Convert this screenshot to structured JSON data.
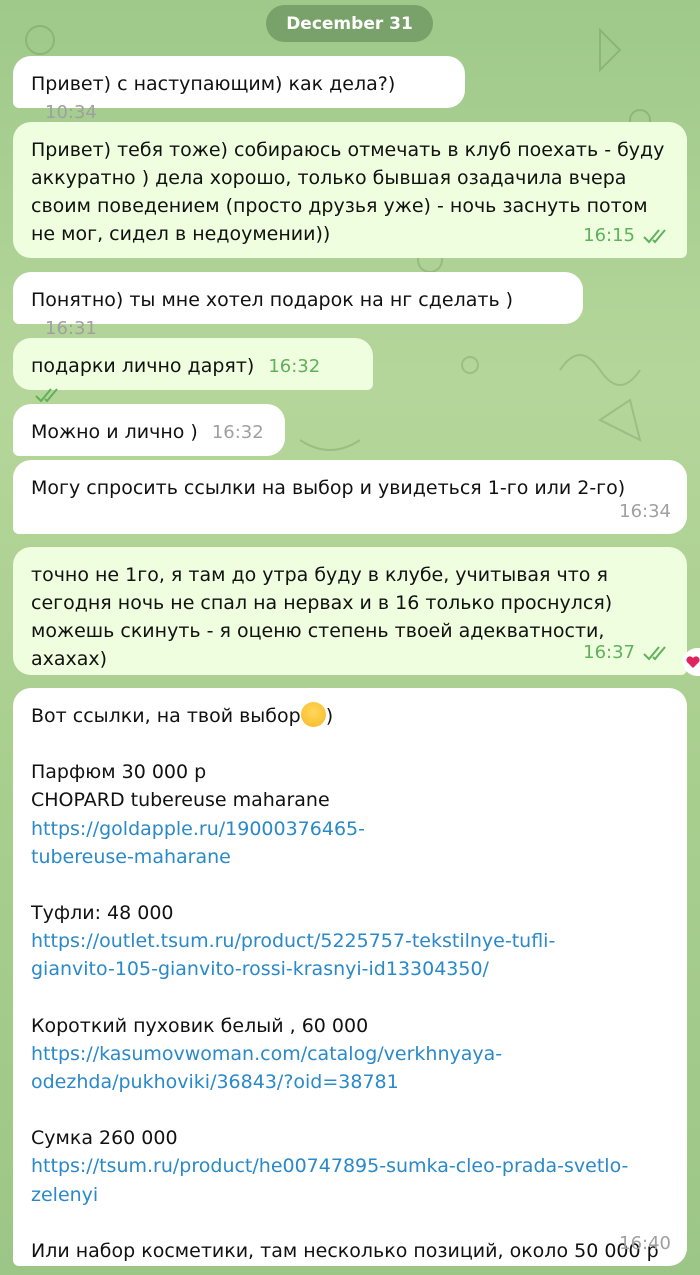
{
  "date_label": "December 31",
  "messages": [
    {
      "dir": "in",
      "text": "Привет) с наступающим) как дела?)",
      "time": "10:34"
    },
    {
      "dir": "out",
      "text": "Привет) тебя тоже) собираюсь отмечать в клуб поехать - буду аккуратно ) дела хорошо, только бывшая озадачила вчера своим поведением (просто друзья уже) - ночь заснуть потом не мог, сидел в недоумении))",
      "time": "16:15"
    },
    {
      "dir": "in",
      "text": "Понятно) ты мне хотел подарок на нг сделать )",
      "time": "16:31"
    },
    {
      "dir": "out",
      "text": "подарки лично дарят)",
      "time": "16:32"
    },
    {
      "dir": "in",
      "text": "Можно и лично )",
      "time": "16:32"
    },
    {
      "dir": "in",
      "text": "Могу спросить ссылки на выбор и увидеться 1-го или 2-го)",
      "time": "16:34"
    },
    {
      "dir": "out",
      "text": "точно не 1го, я там до утра буду в клубе, учитывая что я сегодня ночь не спал на нервах и в 16 только проснулся) можешь скинуть - я оценю степень твоей адекватности, ахахах)",
      "time": "16:37"
    }
  ],
  "links_message": {
    "intro_text": "Вот ссылки, на твой выбор",
    "intro_suffix": ")",
    "perfume_title": "Парфюм 30 000 р",
    "perfume_desc": "CHOPARD tubereuse maharane",
    "perfume_link_1": "https://goldapple.ru/19000376465-",
    "perfume_link_2": "tubereuse-maharane",
    "shoes_title": "Туфли: 48 000",
    "shoes_link_1": "https://outlet.tsum.ru/product/5225757-tekstilnye-tufli-",
    "shoes_link_2": "gianvito-105-gianvito-rossi-krasnyi-id13304350/",
    "jacket_title": "Короткий пуховик белый , 60 000",
    "jacket_link_1": "https://kasumovwoman.com/catalog/verkhnyaya-",
    "jacket_link_2": "odezhda/pukhoviki/36843/?oid=38781",
    "bag_title": "Сумка 260 000",
    "bag_link_1": "https://tsum.ru/product/he00747895-sumka-cleo-prada-svetlo-",
    "bag_link_2": "zelenyi",
    "cosmetics_text": "Или набор косметики, там несколько позиций, около 50 000 р",
    "time": "16:40"
  },
  "colors": {
    "incoming_bubble": "#ffffff",
    "outgoing_bubble": "#eefedf",
    "outgoing_time": "#5fb15a",
    "link": "#2a89c9",
    "reaction": "#e0245e"
  },
  "icons": {
    "read_receipt": "double-check-icon",
    "reaction": "heart-icon",
    "emoji": "smiling-face-emoji"
  }
}
